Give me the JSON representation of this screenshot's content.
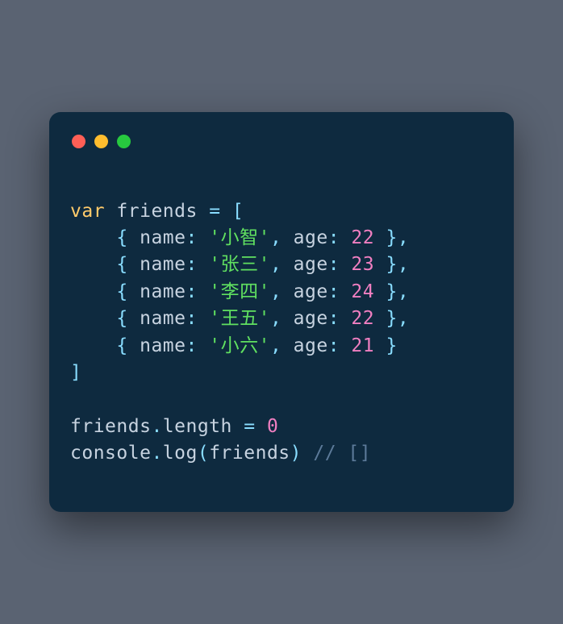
{
  "keywords": {
    "var": "var"
  },
  "idents": {
    "friends": "friends",
    "length": "length",
    "console": "console",
    "log": "log",
    "name": "name",
    "age": "age"
  },
  "friends": [
    {
      "name": "小智",
      "age": "22"
    },
    {
      "name": "张三",
      "age": "23"
    },
    {
      "name": "李四",
      "age": "24"
    },
    {
      "name": "王五",
      "age": "22"
    },
    {
      "name": "小六",
      "age": "21"
    }
  ],
  "zero": "0",
  "comment": "// []"
}
